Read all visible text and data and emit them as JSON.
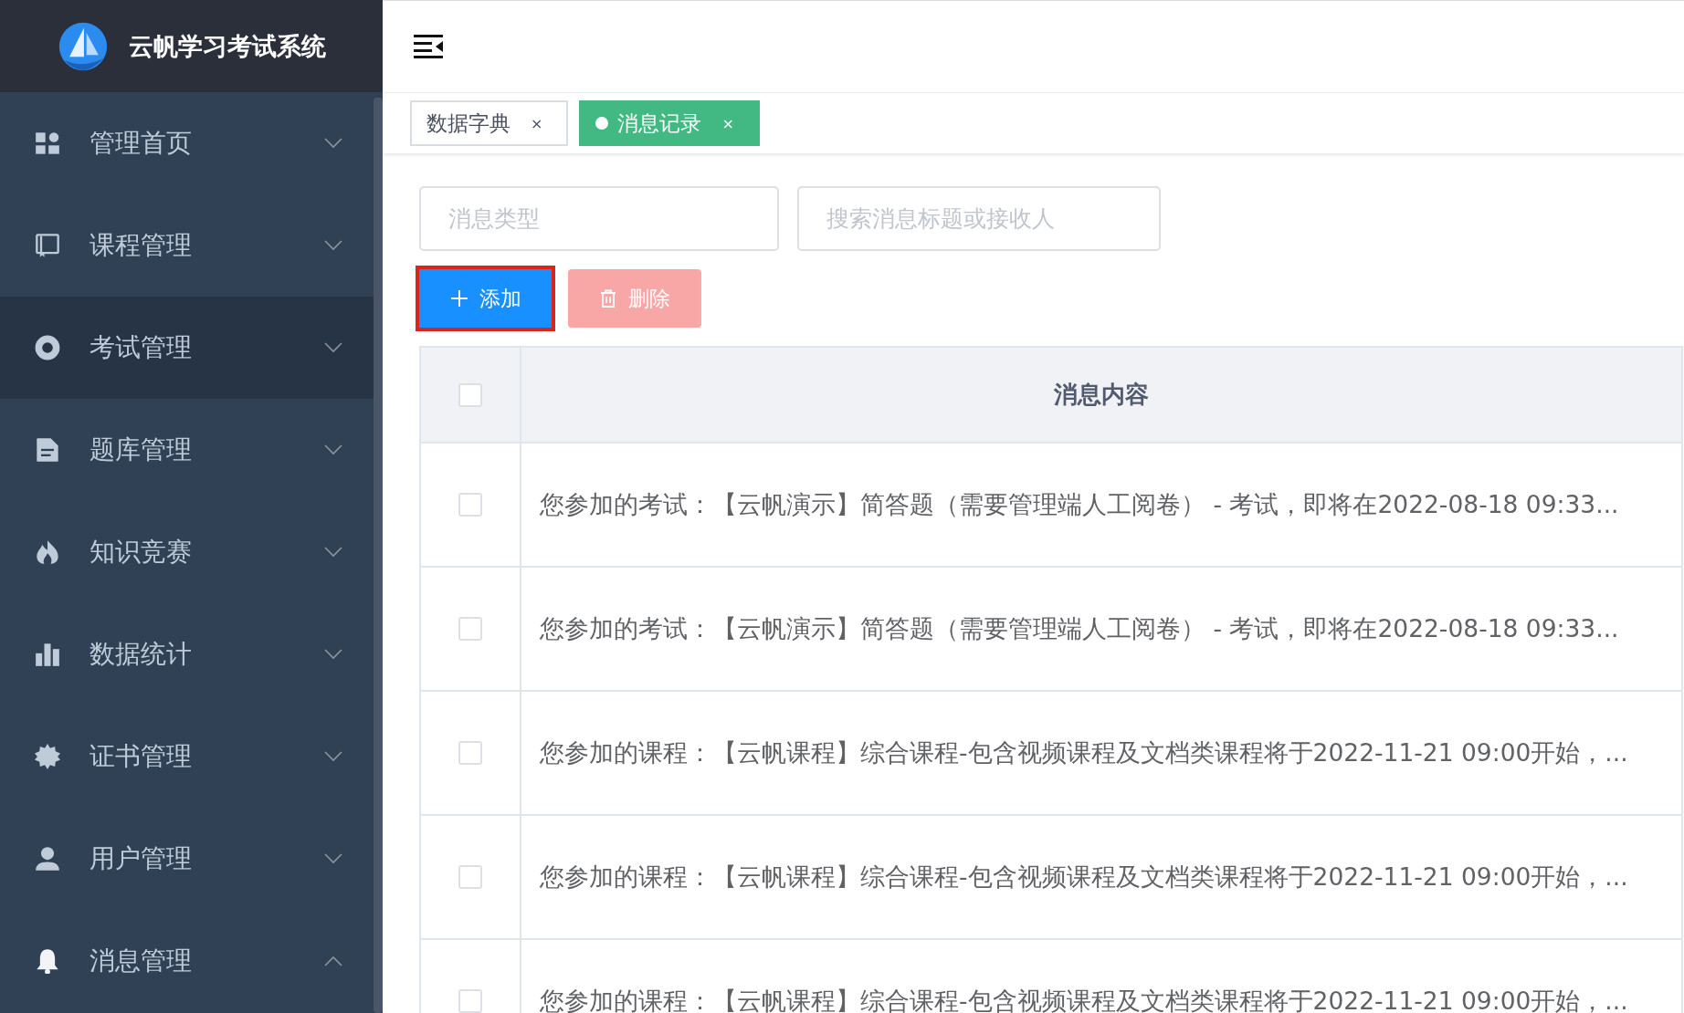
{
  "app": {
    "title": "云帆学习考试系统"
  },
  "sidebar": {
    "items": [
      {
        "label": "管理首页",
        "selected": false,
        "expanded": false
      },
      {
        "label": "课程管理",
        "selected": false,
        "expanded": false
      },
      {
        "label": "考试管理",
        "selected": true,
        "expanded": false
      },
      {
        "label": "题库管理",
        "selected": false,
        "expanded": false
      },
      {
        "label": "知识竞赛",
        "selected": false,
        "expanded": false
      },
      {
        "label": "数据统计",
        "selected": false,
        "expanded": false
      },
      {
        "label": "证书管理",
        "selected": false,
        "expanded": false
      },
      {
        "label": "用户管理",
        "selected": false,
        "expanded": false
      },
      {
        "label": "消息管理",
        "selected": false,
        "expanded": true
      }
    ]
  },
  "tabs": [
    {
      "label": "数据字典",
      "close": "×",
      "selected": false
    },
    {
      "label": "消息记录",
      "close": "×",
      "selected": true
    }
  ],
  "filters": [
    {
      "placeholder": "消息类型"
    },
    {
      "placeholder": "搜索消息标题或接收人"
    }
  ],
  "buttons": [
    {
      "label": "添加",
      "kind": "add",
      "disabled": false,
      "highlighted": true
    },
    {
      "label": "删除",
      "kind": "delete",
      "disabled": true,
      "highlighted": false
    }
  ],
  "table": {
    "columns": [
      "消息内容"
    ],
    "header_checked": false,
    "rows": [
      {
        "checked": false,
        "content": "您参加的考试：【云帆演示】简答题（需要管理端人工阅卷） - 考试，即将在2022-08-18 09:33..."
      },
      {
        "checked": false,
        "content": "您参加的考试：【云帆演示】简答题（需要管理端人工阅卷） - 考试，即将在2022-08-18 09:33..."
      },
      {
        "checked": false,
        "content": "您参加的课程：【云帆课程】综合课程-包含视频课程及文档类课程将于2022-11-21 09:00开始，..."
      },
      {
        "checked": false,
        "content": "您参加的课程：【云帆课程】综合课程-包含视频课程及文档类课程将于2022-11-21 09:00开始，..."
      },
      {
        "checked": false,
        "content": "您参加的课程：【云帆课程】综合课程-包含视频课程及文档类课程将于2022-11-21 09:00开始，..."
      }
    ]
  }
}
